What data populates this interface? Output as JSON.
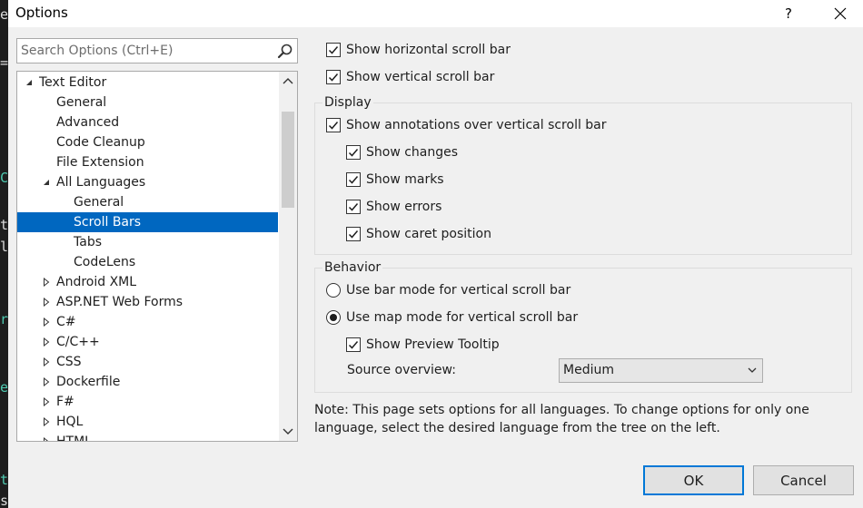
{
  "window": {
    "title": "Options"
  },
  "titlebar": {
    "help": "?"
  },
  "search": {
    "placeholder": "Search Options (Ctrl+E)"
  },
  "tree": {
    "items": [
      {
        "label": "Text Editor",
        "level": 0,
        "arrow": "expanded"
      },
      {
        "label": "General",
        "level": 1,
        "arrow": "none"
      },
      {
        "label": "Advanced",
        "level": 1,
        "arrow": "none"
      },
      {
        "label": "Code Cleanup",
        "level": 1,
        "arrow": "none"
      },
      {
        "label": "File Extension",
        "level": 1,
        "arrow": "none"
      },
      {
        "label": "All Languages",
        "level": 1,
        "arrow": "expanded"
      },
      {
        "label": "General",
        "level": 2,
        "arrow": "none"
      },
      {
        "label": "Scroll Bars",
        "level": 2,
        "arrow": "none",
        "selected": true
      },
      {
        "label": "Tabs",
        "level": 2,
        "arrow": "none"
      },
      {
        "label": "CodeLens",
        "level": 2,
        "arrow": "none"
      },
      {
        "label": "Android XML",
        "level": 1,
        "arrow": "collapsed"
      },
      {
        "label": "ASP.NET Web Forms",
        "level": 1,
        "arrow": "collapsed"
      },
      {
        "label": "C#",
        "level": 1,
        "arrow": "collapsed"
      },
      {
        "label": "C/C++",
        "level": 1,
        "arrow": "collapsed"
      },
      {
        "label": "CSS",
        "level": 1,
        "arrow": "collapsed"
      },
      {
        "label": "Dockerfile",
        "level": 1,
        "arrow": "collapsed"
      },
      {
        "label": "F#",
        "level": 1,
        "arrow": "collapsed"
      },
      {
        "label": "HQL",
        "level": 1,
        "arrow": "collapsed"
      },
      {
        "label": "HTML",
        "level": 1,
        "arrow": "collapsed"
      }
    ]
  },
  "options": {
    "show_horizontal": {
      "label": "Show horizontal scroll bar",
      "checked": true
    },
    "show_vertical": {
      "label": "Show vertical scroll bar",
      "checked": true
    }
  },
  "display": {
    "title": "Display",
    "annotations": {
      "label": "Show annotations over vertical scroll bar",
      "checked": true
    },
    "changes": {
      "label": "Show changes",
      "checked": true
    },
    "marks": {
      "label": "Show marks",
      "checked": true
    },
    "errors": {
      "label": "Show errors",
      "checked": true
    },
    "caret": {
      "label": "Show caret position",
      "checked": true
    }
  },
  "behavior": {
    "title": "Behavior",
    "bar_mode": {
      "label": "Use bar mode for vertical scroll bar",
      "selected": false
    },
    "map_mode": {
      "label": "Use map mode for vertical scroll bar",
      "selected": true
    },
    "preview_tooltip": {
      "label": "Show Preview Tooltip",
      "checked": true
    },
    "source_overview_label": "Source overview:",
    "source_overview_value": "Medium"
  },
  "note": "Note: This page sets options for all languages. To change options for only one language, select the desired language from the tree on the left.",
  "buttons": {
    "ok": "OK",
    "cancel": "Cancel"
  },
  "colors": {
    "selection": "#0067c0",
    "dialog_bg": "#f0f0f0",
    "default_button_border": "#0078d7"
  }
}
